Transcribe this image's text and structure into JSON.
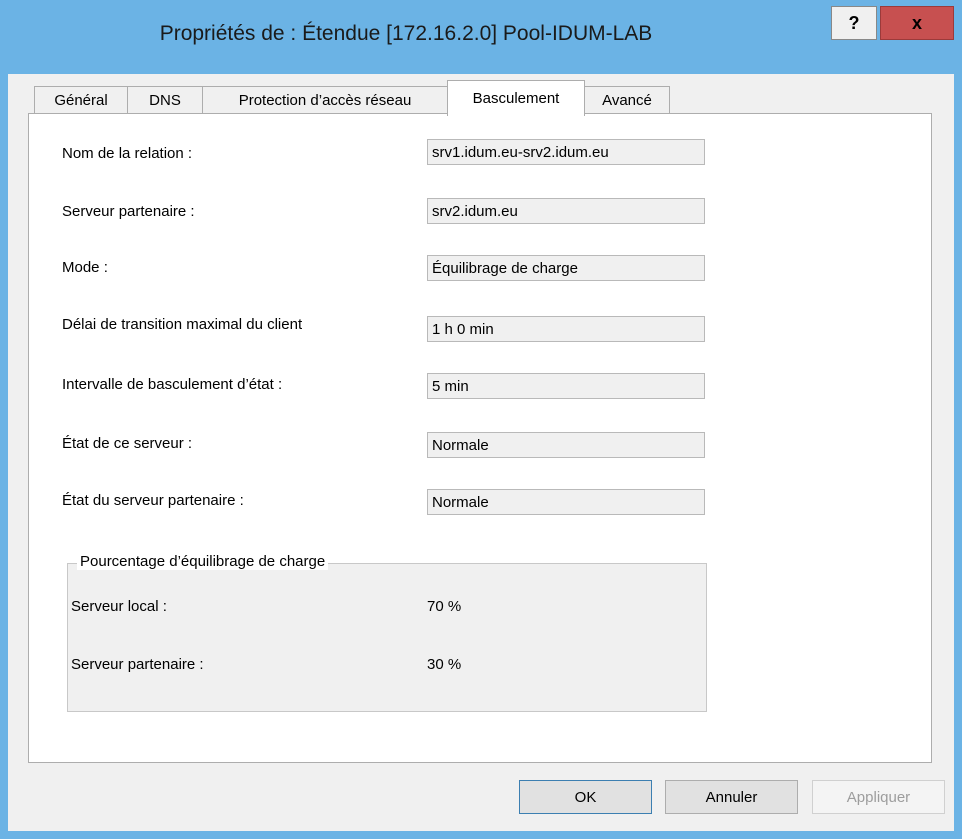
{
  "window": {
    "title": "Propriétés de : Étendue [172.16.2.0] Pool-IDUM-LAB",
    "help_label": "?",
    "close_label": "x"
  },
  "tabs": [
    {
      "label": "Général"
    },
    {
      "label": "DNS"
    },
    {
      "label": "Protection d’accès réseau"
    },
    {
      "label": "Basculement",
      "active": true
    },
    {
      "label": "Avancé"
    }
  ],
  "failover": {
    "relation_name_label": "Nom de la relation :",
    "relation_name_value": "srv1.idum.eu-srv2.idum.eu",
    "partner_server_label": "Serveur partenaire :",
    "partner_server_value": "srv2.idum.eu",
    "mode_label": "Mode :",
    "mode_value": "Équilibrage de charge",
    "mclt_label": "Délai de transition maximal du client",
    "mclt_value": "1 h 0 min",
    "state_switchover_label": "Intervalle de basculement d’état :",
    "state_switchover_value": "5 min",
    "this_server_state_label": "État de ce serveur :",
    "this_server_state_value": "Normale",
    "partner_state_label": "État du serveur partenaire :",
    "partner_state_value": "Normale"
  },
  "load_balance": {
    "group_label": "Pourcentage d’équilibrage de charge",
    "local_label": "Serveur local :",
    "local_value": "70 %",
    "partner_label": "Serveur partenaire :",
    "partner_value": "30 %"
  },
  "buttons": {
    "ok": "OK",
    "cancel": "Annuler",
    "apply": "Appliquer"
  }
}
